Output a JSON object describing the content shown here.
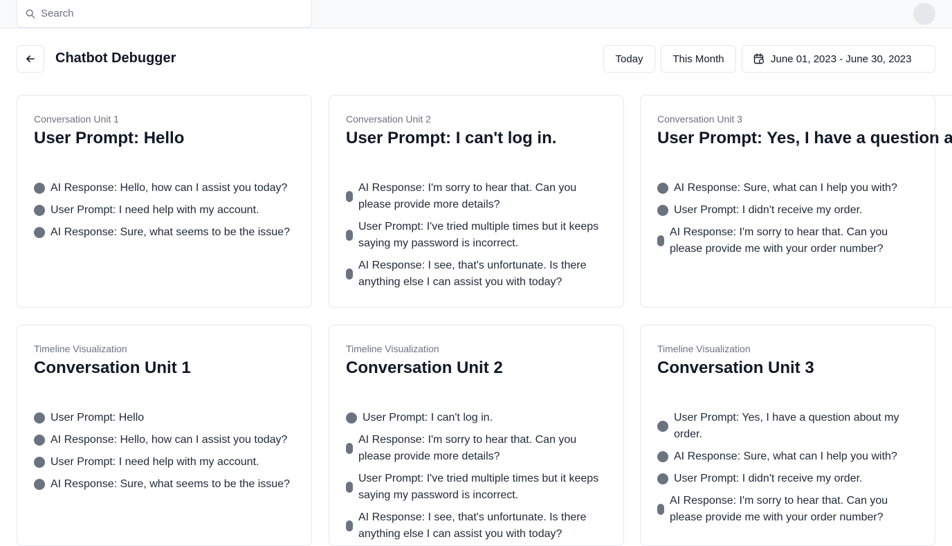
{
  "search": {
    "placeholder": "Search",
    "icon": "search-icon"
  },
  "header": {
    "title": "Chatbot Debugger",
    "back_icon": "arrow-left-icon",
    "today_label": "Today",
    "month_label": "This Month",
    "date_range": "June 01, 2023 - June 30, 2023",
    "calendar_icon": "calendar-icon"
  },
  "colors": {
    "dot": "#6b7280",
    "border": "#e5e7eb",
    "muted": "#6b7280"
  },
  "cards": [
    {
      "kicker": "Conversation Unit 1",
      "title": "User Prompt: Hello",
      "items": [
        {
          "text": "AI Response: Hello, how can I assist you today?",
          "marker": "dot"
        },
        {
          "text": "User Prompt: I need help with my account.",
          "marker": "dot"
        },
        {
          "text": "AI Response: Sure, what seems to be the issue?",
          "marker": "dot"
        }
      ]
    },
    {
      "kicker": "Conversation Unit 2",
      "title": "User Prompt: I can't log in.",
      "items": [
        {
          "text": "AI Response: I'm sorry to hear that. Can you please provide more details?",
          "marker": "pill"
        },
        {
          "text": "User Prompt: I've tried multiple times but it keeps saying my password is incorrect.",
          "marker": "pill"
        },
        {
          "text": "AI Response: I see, that's unfortunate. Is there anything else I can assist you with today?",
          "marker": "pill"
        }
      ]
    },
    {
      "kicker": "Conversation Unit 3",
      "title": "User Prompt: Yes, I have a question about my order.",
      "items": [
        {
          "text": "AI Response: Sure, what can I help you with?",
          "marker": "dot"
        },
        {
          "text": "User Prompt: I didn't receive my order.",
          "marker": "dot"
        },
        {
          "text": "AI Response: I'm sorry to hear that. Can you please provide me with your order number?",
          "marker": "pill"
        }
      ]
    },
    {
      "kicker": "Timeline Visualization",
      "title": "Conversation Unit 1",
      "items": [
        {
          "text": "User Prompt: Hello",
          "marker": "dot"
        },
        {
          "text": "AI Response: Hello, how can I assist you today?",
          "marker": "dot"
        },
        {
          "text": "User Prompt: I need help with my account.",
          "marker": "dot"
        },
        {
          "text": "AI Response: Sure, what seems to be the issue?",
          "marker": "dot"
        }
      ]
    },
    {
      "kicker": "Timeline Visualization",
      "title": "Conversation Unit 2",
      "items": [
        {
          "text": "User Prompt: I can't log in.",
          "marker": "dot"
        },
        {
          "text": "AI Response: I'm sorry to hear that. Can you please provide more details?",
          "marker": "pill"
        },
        {
          "text": "User Prompt: I've tried multiple times but it keeps saying my password is incorrect.",
          "marker": "pill"
        },
        {
          "text": "AI Response: I see, that's unfortunate. Is there anything else I can assist you with today?",
          "marker": "pill"
        }
      ]
    },
    {
      "kicker": "Timeline Visualization",
      "title": "Conversation Unit 3",
      "items": [
        {
          "text": "User Prompt: Yes, I have a question about my order.",
          "marker": "dot"
        },
        {
          "text": "AI Response: Sure, what can I help you with?",
          "marker": "dot"
        },
        {
          "text": "User Prompt: I didn't receive my order.",
          "marker": "dot"
        },
        {
          "text": "AI Response: I'm sorry to hear that. Can you please provide me with your order number?",
          "marker": "pill"
        }
      ]
    }
  ]
}
